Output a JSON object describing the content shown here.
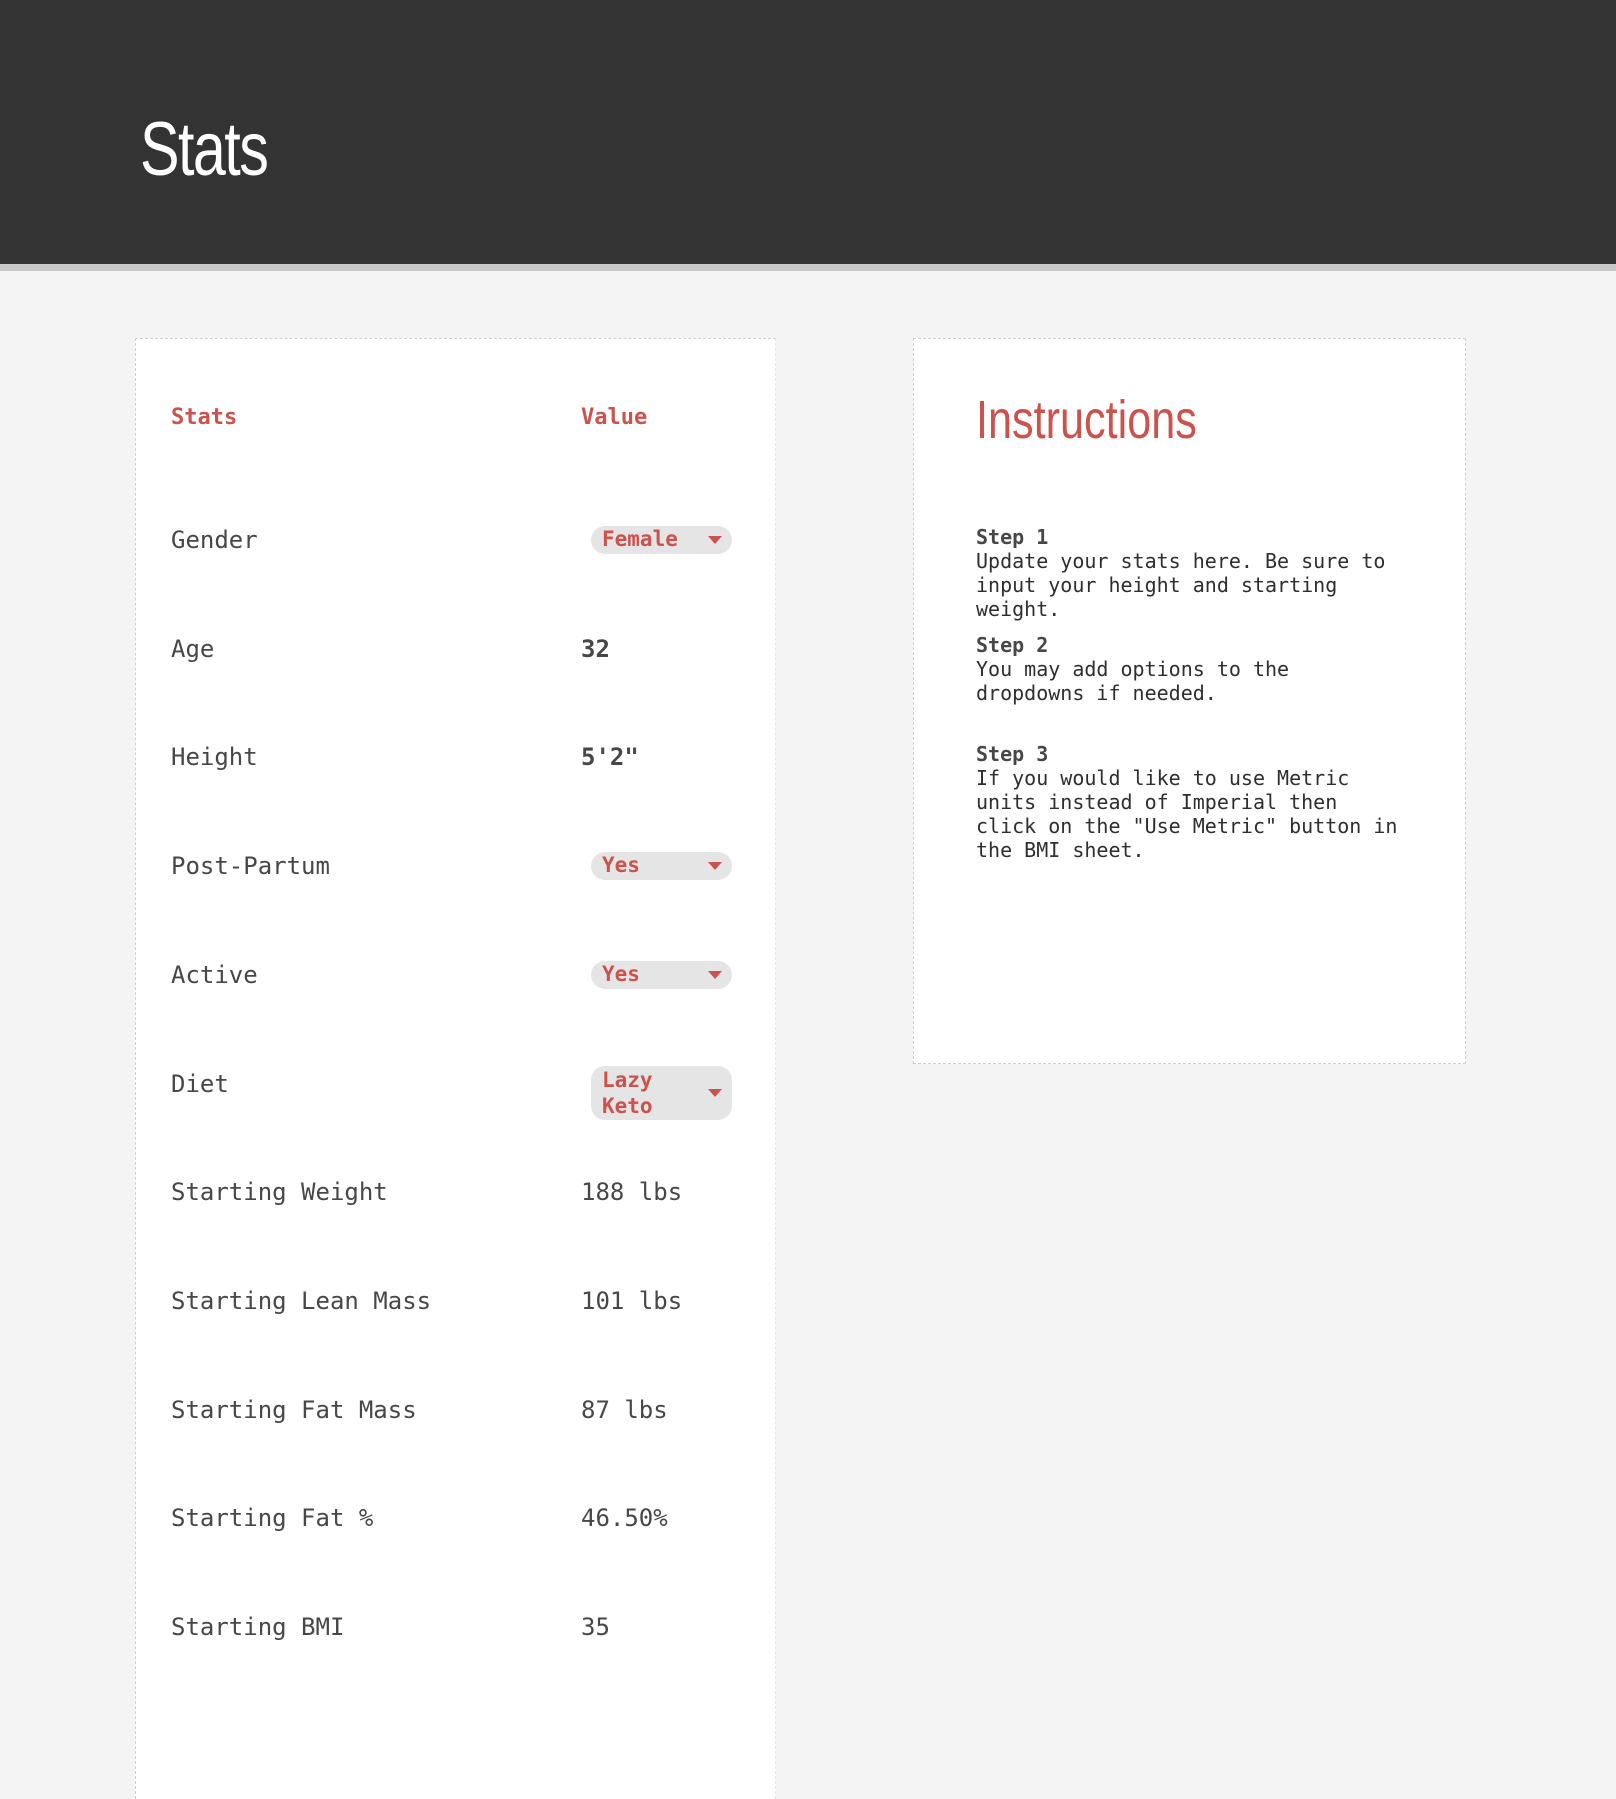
{
  "header": {
    "title": "Stats"
  },
  "stats_table": {
    "col_stat": "Stats",
    "col_value": "Value",
    "rows": [
      {
        "label": "Gender",
        "value": "Female",
        "kind": "dropdown"
      },
      {
        "label": "Age",
        "value": "32",
        "kind": "bold"
      },
      {
        "label": "Height",
        "value": "5'2\"",
        "kind": "bold"
      },
      {
        "label": "Post-Partum",
        "value": "Yes",
        "kind": "dropdown"
      },
      {
        "label": "Active",
        "value": "Yes",
        "kind": "dropdown"
      },
      {
        "label": "Diet",
        "value": "Lazy Keto",
        "value_line1": "Lazy",
        "value_line2": "Keto",
        "kind": "dropdown"
      },
      {
        "label": "Starting Weight",
        "value": "188 lbs",
        "kind": "plain"
      },
      {
        "label": "Starting Lean Mass",
        "value": "101 lbs",
        "kind": "plain"
      },
      {
        "label": "Starting Fat Mass",
        "value": "87 lbs",
        "kind": "plain"
      },
      {
        "label": "Starting Fat %",
        "value": "46.50%",
        "kind": "plain"
      },
      {
        "label": "Starting BMI",
        "value": "35",
        "kind": "plain"
      }
    ]
  },
  "instructions": {
    "title": "Instructions",
    "steps": [
      {
        "title": "Step 1",
        "body": "Update your stats here. Be sure to\ninput your height and starting\nweight."
      },
      {
        "title": "Step 2",
        "body": "You may add options to the\ndropdowns if needed."
      },
      {
        "title": "Step 3",
        "body": "If you would like to use Metric\nunits instead of Imperial then\nclick on the \"Use Metric\" button in\nthe BMI sheet."
      }
    ]
  },
  "colors": {
    "header_bg": "#333333",
    "accent_red": "#cc524d",
    "page_bg": "#f4f4f4",
    "dropdown_bg": "#e5e5e5"
  }
}
